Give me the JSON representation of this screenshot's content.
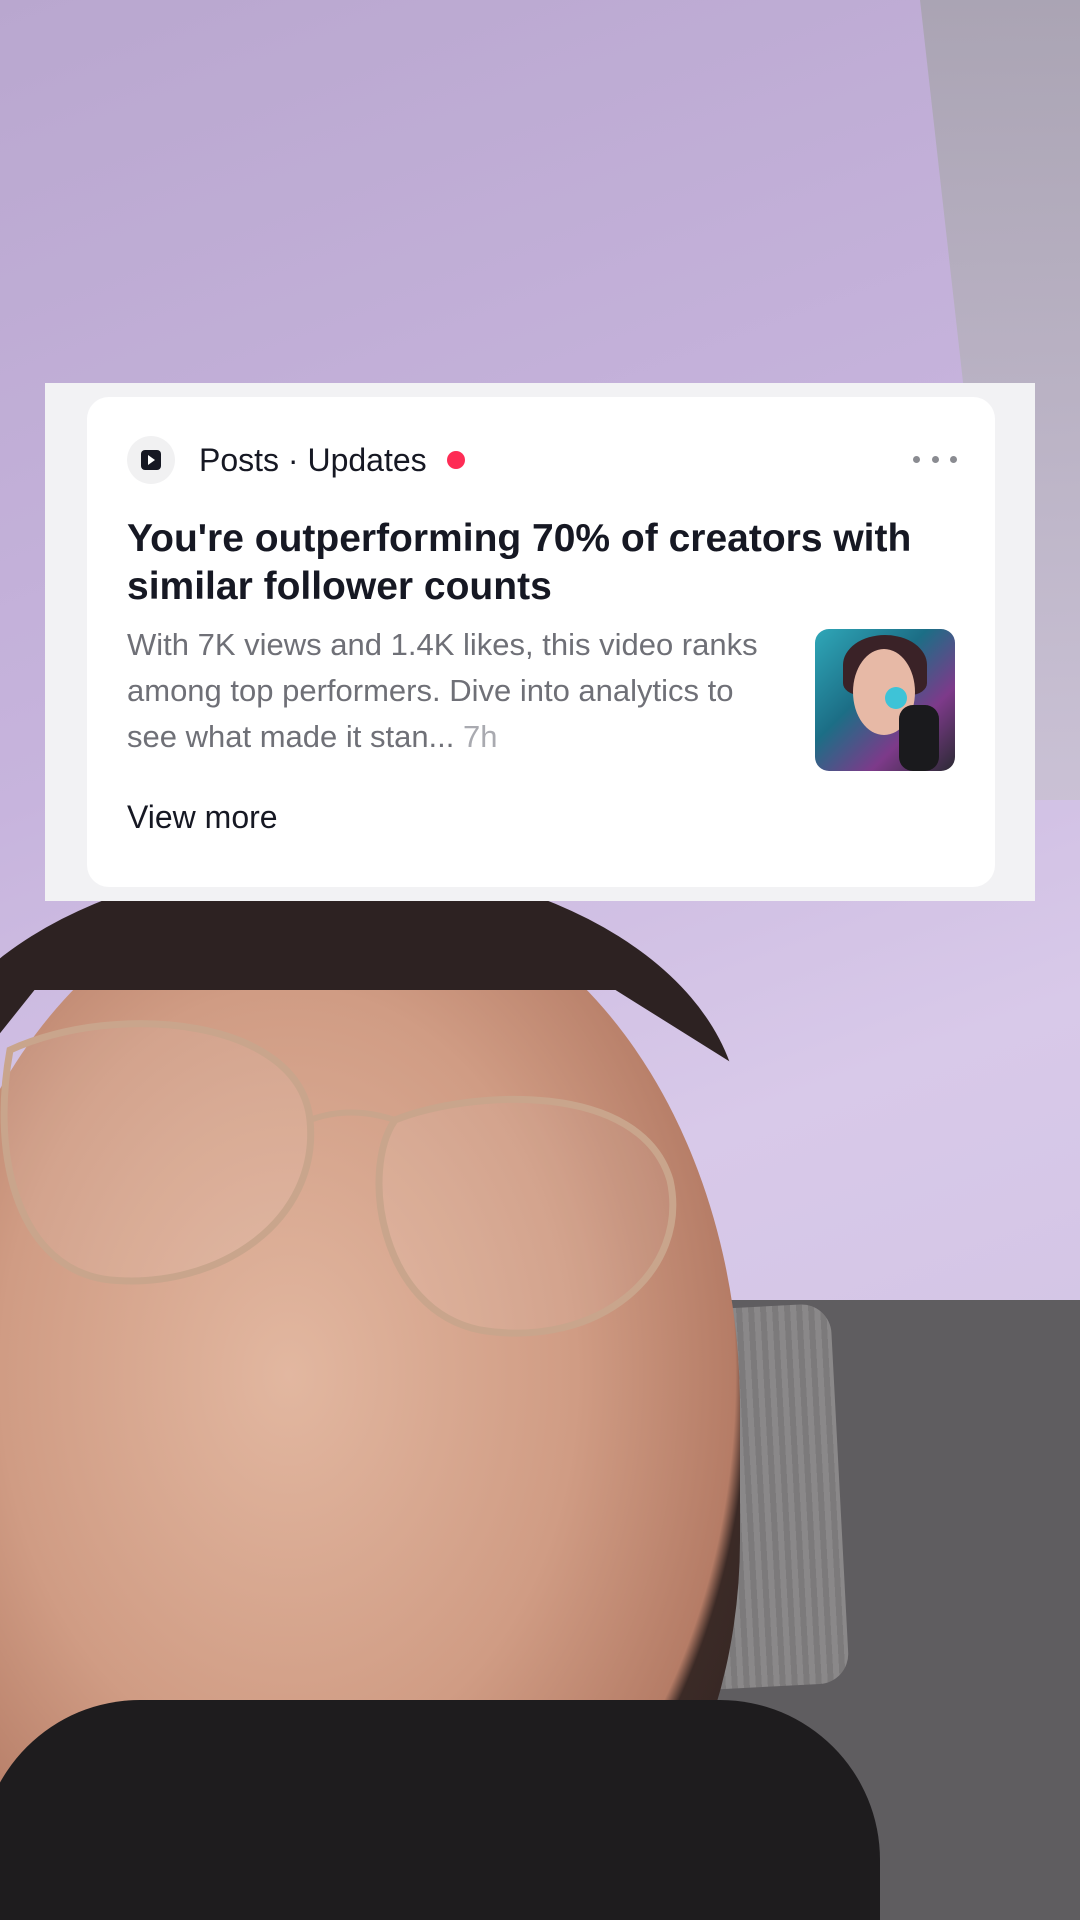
{
  "notification": {
    "header": "Posts · Updates",
    "title": "You're outperforming 70% of creators with similar follower counts",
    "body": "With 7K views and 1.4K likes, this video ranks among top performers. Dive into analytics to see what made it stan...",
    "time": "7h",
    "view_more": "View more",
    "colors": {
      "unread_dot": "#fe2c55",
      "title_text": "#161823",
      "body_text": "#6f7077"
    }
  }
}
